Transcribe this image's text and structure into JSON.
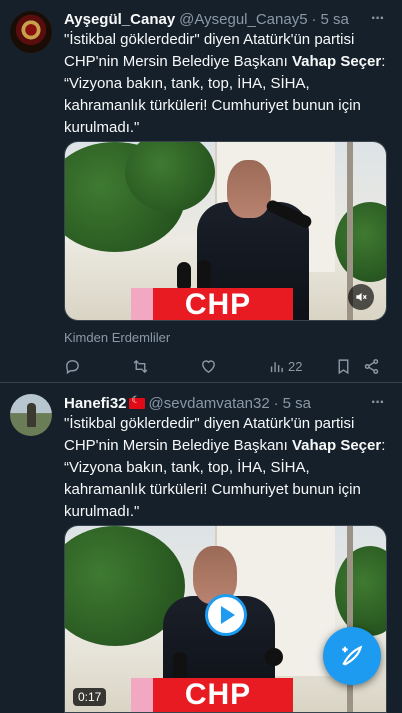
{
  "tweets": [
    {
      "name": "Ayşegül_Canay",
      "handle": "@Aysegul_Canay5",
      "dot": "·",
      "time": "5 sa",
      "text_parts": [
        "\"İstikbal göklerdedir\" diyen Atatürk'ün partisi CHP'nin Mersin Belediye Başkanı ",
        "Vahap Seçer",
        ": “Vizyona bakın, tank, top, İHA, SİHA, kahramanlık türküleri! Cumhuriyet bunun için kurulmadı.\""
      ],
      "banner": "CHP",
      "footer_note": "Kimden Erdemliler",
      "views": "22"
    },
    {
      "name": "Hanefi32",
      "handle": "@sevdamvatan32",
      "dot": "·",
      "time": "5 sa",
      "text_parts": [
        "\"İstikbal göklerdedir\" diyen Atatürk'ün partisi CHP'nin Mersin Belediye Başkanı ",
        "Vahap Seçer",
        ": “Vizyona bakın, tank, top, İHA, SİHA, kahramanlık türküleri! Cumhuriyet bunun için kurulmadı.\""
      ],
      "banner": "CHP",
      "duration": "0:17"
    }
  ],
  "more_glyph": "···",
  "colors": {
    "background": "#15202b",
    "accent": "#1d9bf0",
    "muted": "#8b98a5",
    "divider": "#38444d"
  }
}
